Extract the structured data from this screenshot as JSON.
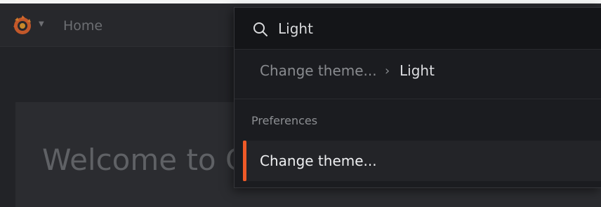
{
  "app": {
    "breadcrumb_home": "Home",
    "welcome_title": "Welcome to G"
  },
  "palette": {
    "search_value": "Light",
    "breadcrumb": {
      "parent": "Change theme...",
      "separator": "›",
      "current": "Light"
    },
    "section_label": "Preferences",
    "results": [
      {
        "label": "Change theme...",
        "selected": true
      }
    ]
  },
  "colors": {
    "accent": "#f05a28",
    "palette_bg": "#1b1c20",
    "app_bg": "#222327"
  },
  "icons": {
    "logo": "grafana-logo-icon",
    "caret": "chevron-down-icon",
    "search": "search-icon"
  }
}
